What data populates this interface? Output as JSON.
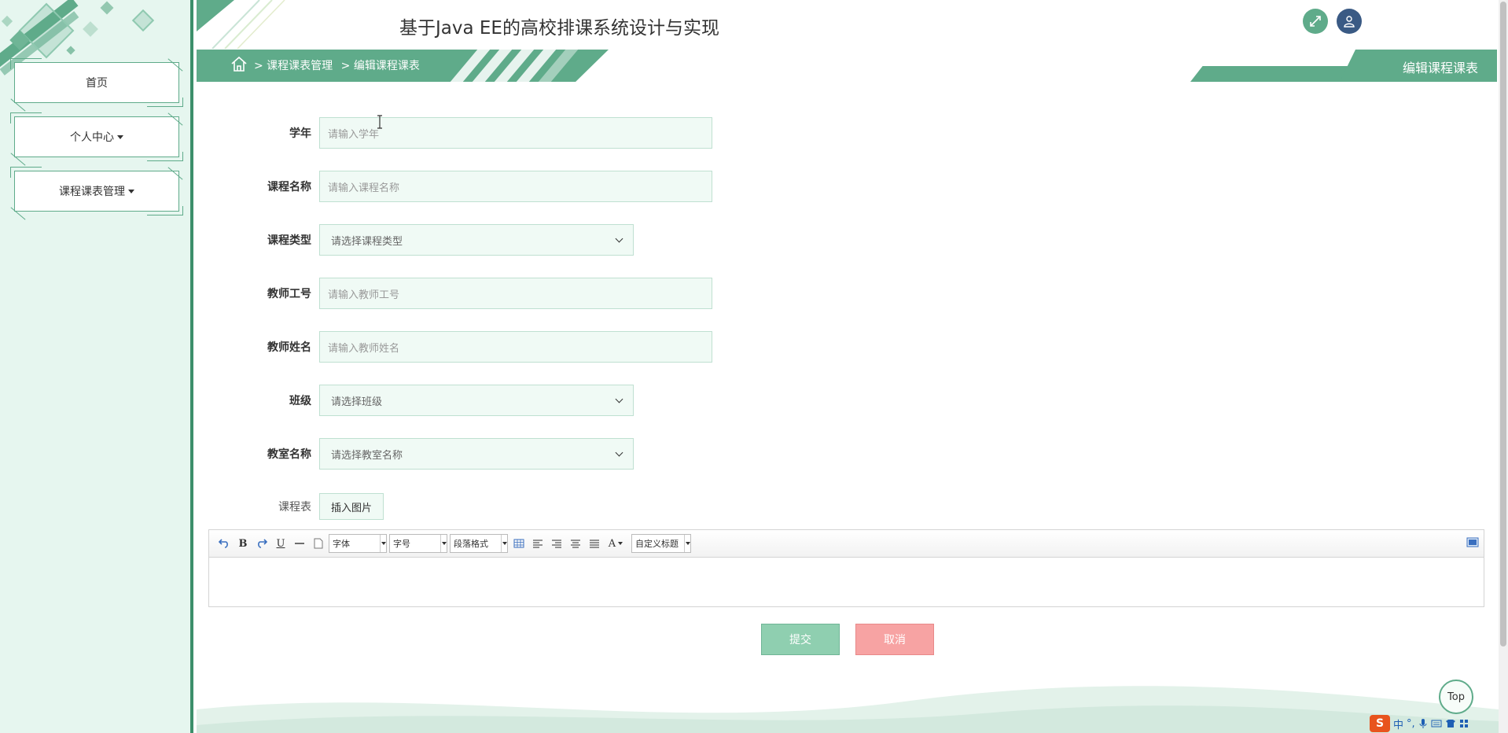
{
  "app": {
    "title": "基于Java EE的高校排课系统设计与实现"
  },
  "sidebar": {
    "items": [
      {
        "label": "首页",
        "has_caret": false
      },
      {
        "label": "个人中心",
        "has_caret": true
      },
      {
        "label": "课程课表管理",
        "has_caret": true
      }
    ]
  },
  "breadcrumb": {
    "home_icon": "home-icon",
    "items": [
      "> 课程课表管理",
      "> 编辑课程课表"
    ]
  },
  "page_tab": {
    "title": "编辑课程课表"
  },
  "header_icons": {
    "fullscreen": "expand-icon",
    "user": "user-icon"
  },
  "form": {
    "academic_year": {
      "label": "学年",
      "placeholder": "请输入学年"
    },
    "course_name": {
      "label": "课程名称",
      "placeholder": "请输入课程名称"
    },
    "course_type": {
      "label": "课程类型",
      "selected": "请选择课程类型"
    },
    "teacher_id": {
      "label": "教师工号",
      "placeholder": "请输入教师工号"
    },
    "teacher_name": {
      "label": "教师姓名",
      "placeholder": "请输入教师姓名"
    },
    "class": {
      "label": "班级",
      "selected": "请选择班级"
    },
    "classroom": {
      "label": "教室名称",
      "selected": "请选择教室名称"
    },
    "schedule": {
      "label": "课程表",
      "insert_image": "插入图片"
    }
  },
  "editor": {
    "font_family": "字体",
    "font_size": "字号",
    "paragraph": "段落格式",
    "custom_title": "自定义标题",
    "bold_glyph": "B",
    "underline_glyph": "U",
    "color_glyph": "A"
  },
  "actions": {
    "submit": "提交",
    "cancel": "取消"
  },
  "back_to_top": "Top",
  "ime": {
    "mode": "中"
  },
  "colors": {
    "primary": "#5fab8a",
    "sidebar_bg": "#e6f6ef",
    "cancel": "#f7a3a3",
    "submit": "#8fcfb0"
  }
}
